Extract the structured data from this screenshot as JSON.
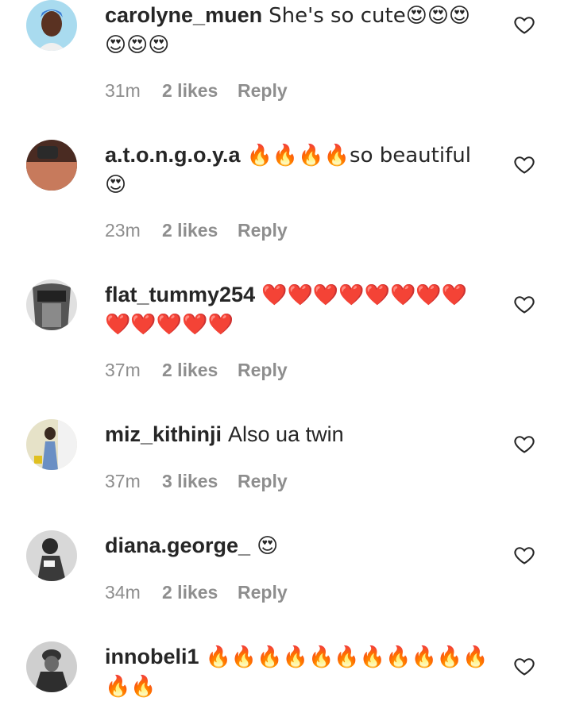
{
  "comments": [
    {
      "username": "carolyne_muen",
      "text": "She's so cute😍😍😍😍😍😍",
      "time": "31m",
      "likes": "2 likes",
      "reply": "Reply",
      "avatar_color": "#9fd3ea"
    },
    {
      "username": "a.t.o.n.g.o.y.a",
      "text": "🔥🔥🔥🔥so beautiful 😍",
      "time": "23m",
      "likes": "2 likes",
      "reply": "Reply",
      "avatar_color": "#8a5a4a"
    },
    {
      "username": "flat_tummy254",
      "text": "❤️❤️❤️❤️❤️❤️❤️❤️❤️❤️❤️❤️❤️",
      "time": "37m",
      "likes": "2 likes",
      "reply": "Reply",
      "avatar_color": "#bdbdbd"
    },
    {
      "username": "miz_kithinji",
      "text": "Also ua twin",
      "time": "37m",
      "likes": "3 likes",
      "reply": "Reply",
      "avatar_color": "#d9d2b3"
    },
    {
      "username": "diana.george_",
      "text": "😍",
      "time": "34m",
      "likes": "2 likes",
      "reply": "Reply",
      "avatar_color": "#cfcfcf"
    },
    {
      "username": "innobeli1",
      "text": "🔥🔥🔥🔥🔥🔥🔥🔥🔥🔥🔥🔥🔥",
      "time": "",
      "likes": "",
      "reply": "",
      "avatar_color": "#9a9a9a"
    }
  ]
}
